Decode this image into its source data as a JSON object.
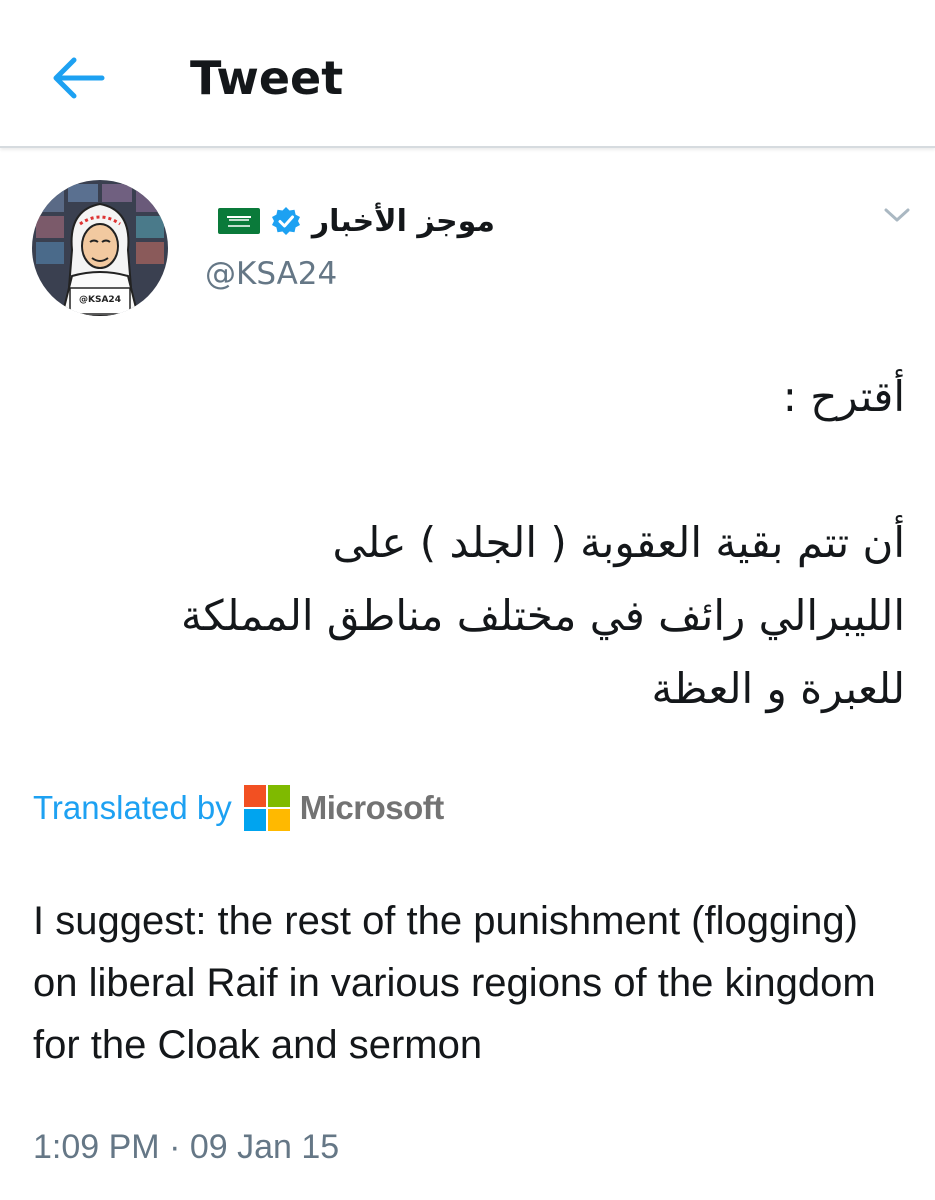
{
  "header": {
    "title": "Tweet",
    "back_icon": "back-arrow-icon",
    "accent_color": "#1da1f2"
  },
  "tweet": {
    "author": {
      "display_name": "موجز الأخبار",
      "handle": "@KSA24",
      "avatar_caption": "@KSA24",
      "verified": true,
      "flag": "saudi-flag-icon"
    },
    "text_ar": "أقترح :\n\nأن تتم بقية العقوبة ( الجلد ) على\nالليبرالي رائف في مختلف مناطق المملكة\nللعبرة و العظة",
    "translation": {
      "label": "Translated by",
      "provider": "Microsoft",
      "text": "I suggest: the rest of the punishment (flogging) on liberal Raif in various regions of the kingdom for the Cloak and sermon"
    },
    "timestamp": "1:09 PM · 09 Jan 15"
  }
}
